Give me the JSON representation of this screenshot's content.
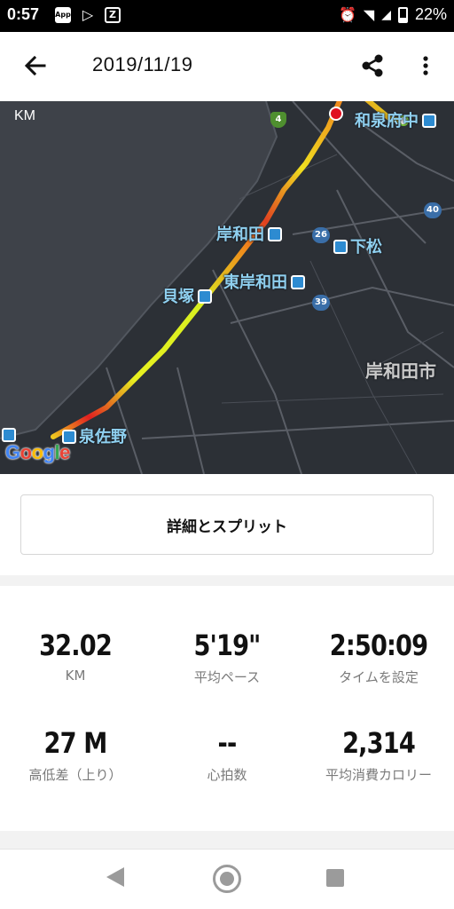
{
  "status_bar": {
    "time": "0:57",
    "left_icons": [
      {
        "name": "app-notification-icon",
        "text": "App"
      },
      {
        "name": "play-store-icon",
        "text": ""
      },
      {
        "name": "app-icon-z",
        "text": ""
      }
    ],
    "battery": "22%"
  },
  "app_bar": {
    "title": "2019/11/19",
    "back_icon": "arrow-left-icon",
    "share_icon": "share-icon",
    "more_icon": "more-vertical-icon"
  },
  "map": {
    "unit": "KM",
    "places": {
      "izumifuchu": "和泉府中",
      "kishiwada": "岸和田",
      "shimomatsu": "下松",
      "kaizuka": "貝塚",
      "higashi_kishiwada": "東岸和田",
      "kishiwada_city": "岸和田市",
      "izumisano": "泉佐野"
    },
    "route_numbers": {
      "r4": "4",
      "r26": "26",
      "r39": "39",
      "r40": "40"
    },
    "attribution": "Google",
    "route_colors": {
      "slow": "#e02020",
      "mid": "#f08a1c",
      "fast": "#d8f020"
    }
  },
  "split_button": {
    "label": "詳細とスプリット"
  },
  "stats": {
    "distance": {
      "value": "32.02",
      "label": "KM"
    },
    "pace": {
      "value": "5'19\"",
      "label": "平均ペース"
    },
    "time": {
      "value": "2:50:09",
      "label": "タイムを設定"
    },
    "elevation": {
      "value": "27 M",
      "label": "高低差（上り）"
    },
    "heart_rate": {
      "value": "--",
      "label": "心拍数"
    },
    "calories": {
      "value": "2,314",
      "label": "平均消費カロリー"
    }
  }
}
